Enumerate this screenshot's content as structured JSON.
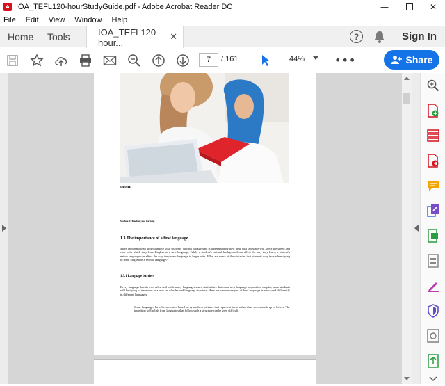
{
  "window": {
    "title": "IOA_TEFL120-hourStudyGuide.pdf - Adobe Acrobat Reader DC",
    "app_icon_text": "A"
  },
  "menu": [
    "File",
    "Edit",
    "View",
    "Window",
    "Help"
  ],
  "tabs": {
    "home": "Home",
    "tools": "Tools",
    "document": "IOA_TEFL120-hour...",
    "help_glyph": "?",
    "signin": "Sign In"
  },
  "toolbar": {
    "page_current": "7",
    "page_total": "/  161",
    "zoom": "44%",
    "more": "•••",
    "share": "Share"
  },
  "document": {
    "home_label": "HOME",
    "module_label": "Module 1: Teaching and learning",
    "heading": "1.3 The importance of a first language",
    "para1": "More important than understanding your students' cultural background is understanding how their first language will affect the speed and ease with which they learn English as a new language. While a student's cultural background can affect the way they learn, a student's native language can affect the way they view language to begin with. What are some of the obstacles that students may face when trying to learn English as a second language?",
    "subheading": "1.3.1 Language barriers",
    "para2": "Every language has its own rules, and while many languages share similarities that make new language acquisition simpler, some students will be trying to transition to a new set of rules and language structure. Here are some examples of how language is structured differently in different languages:",
    "bullet_mark": "•",
    "bullet1": "Some languages have been created based on symbols or pictures that represent ideas rather than words made up of letters. The transition to English from languages that follow such a structure can be very difficult."
  },
  "colors": {
    "accent": "#1473e6",
    "workspace": "#d6d6d6",
    "acrobat_red": "#d6101c"
  }
}
